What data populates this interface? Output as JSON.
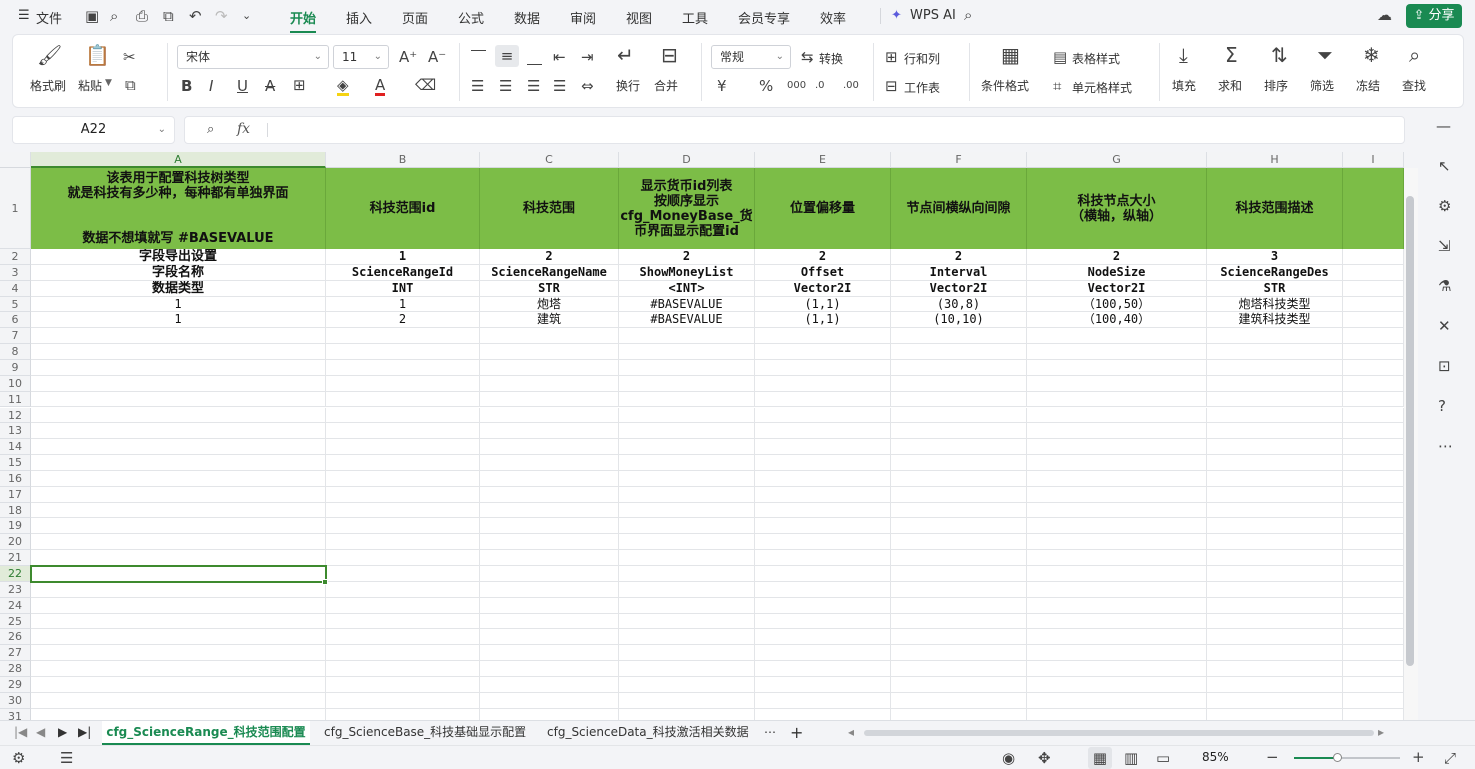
{
  "menubar": {
    "file_label": "文件",
    "tabs": [
      "开始",
      "插入",
      "页面",
      "公式",
      "数据",
      "审阅",
      "视图",
      "工具",
      "会员专享",
      "效率"
    ],
    "active_tab": "开始",
    "wps_ai": "WPS AI",
    "share": "分享"
  },
  "ribbon": {
    "format_painter": "格式刷",
    "paste": "粘贴",
    "font_name": "宋体",
    "font_size": "11",
    "wrap": "换行",
    "merge": "合并",
    "number_format": "常规",
    "convert": "转换",
    "row_col": "行和列",
    "worksheet": "工作表",
    "cond_format": "条件格式",
    "table_style": "表格样式",
    "cell_style": "单元格样式",
    "fill": "填充",
    "sum": "求和",
    "sort": "排序",
    "filter": "筛选",
    "freeze": "冻结",
    "find": "查找"
  },
  "formula_bar": {
    "name_box": "A22",
    "fx": "fx",
    "value": ""
  },
  "sheet": {
    "columns": [
      {
        "id": "A",
        "label": "A"
      },
      {
        "id": "B",
        "label": "B"
      },
      {
        "id": "C",
        "label": "C"
      },
      {
        "id": "D",
        "label": "D"
      },
      {
        "id": "E",
        "label": "E"
      },
      {
        "id": "F",
        "label": "F"
      },
      {
        "id": "G",
        "label": "G"
      },
      {
        "id": "H",
        "label": "H"
      },
      {
        "id": "I",
        "label": "I"
      }
    ],
    "header_row": {
      "A_lines": [
        "该表用于配置科技树类型",
        "就是科技有多少种，每种都有单独界面",
        "",
        "",
        "数据不想填就写 #BASEVALUE"
      ],
      "B": "科技范围id",
      "C": "科技范围",
      "D_lines": [
        "显示货币id列表",
        "按顺序显示",
        "cfg_MoneyBase_货",
        "币界面显示配置id"
      ],
      "E": "位置偏移量",
      "F": "节点间横纵向间隙",
      "G_lines": [
        "科技节点大小",
        "（横轴，纵轴）"
      ],
      "H": "科技范围描述"
    },
    "rows": [
      [
        "字段导出设置",
        "1",
        "2",
        "2",
        "2",
        "2",
        "2",
        "3"
      ],
      [
        "字段名称",
        "ScienceRangeId",
        "ScienceRangeName",
        "ShowMoneyList",
        "Offset",
        "Interval",
        "NodeSize",
        "ScienceRangeDes"
      ],
      [
        "数据类型",
        "INT",
        "STR",
        "<INT>",
        "Vector2I",
        "Vector2I",
        "Vector2I",
        "STR"
      ],
      [
        "1",
        "1",
        "炮塔",
        "#BASEVALUE",
        "(1,1)",
        "(30,8)",
        "（100,50）",
        "炮塔科技类型"
      ],
      [
        "1",
        "2",
        "建筑",
        "#BASEVALUE",
        "(1,1)",
        "(10,10)",
        "（100,40）",
        "建筑科技类型"
      ]
    ],
    "row_numbers": [
      "1",
      "2",
      "3",
      "4",
      "5",
      "6",
      "7",
      "8",
      "9",
      "10",
      "11",
      "12",
      "13",
      "14",
      "15",
      "16",
      "17",
      "18",
      "19",
      "20",
      "21",
      "22",
      "23",
      "24",
      "25",
      "26",
      "27",
      "28",
      "29",
      "30",
      "31"
    ],
    "selected_cell": "A22",
    "header_color": "#7cbd47"
  },
  "sheet_tabs": [
    "cfg_ScienceRange_科技范围配置",
    "cfg_ScienceBase_科技基础显示配置",
    "cfg_ScienceData_科技激活相关数据"
  ],
  "active_sheet": "cfg_ScienceRange_科技范围配置",
  "status": {
    "zoom": "85%"
  },
  "colors": {
    "accent": "#1a8a52",
    "header_green": "#7cbd47",
    "selection": "#3d8a2e"
  }
}
